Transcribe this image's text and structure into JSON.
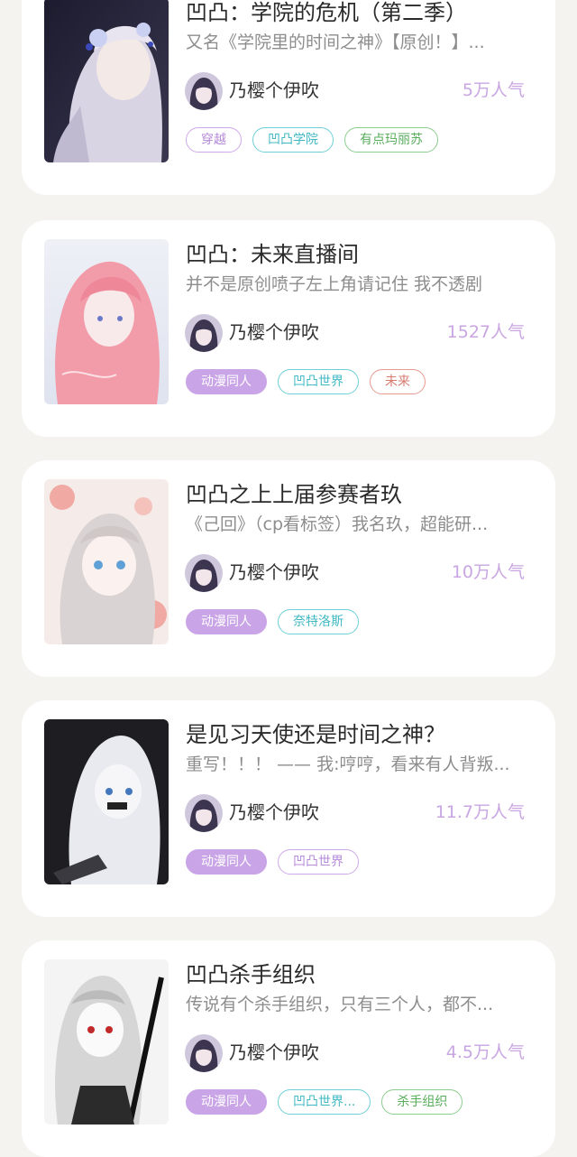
{
  "books": [
    {
      "title": "凹凸：学院的危机（第二季）",
      "description": "又名《学院里的时间之神》【原创！】...",
      "author": "乃樱个伊吹",
      "popularity": "5万人气",
      "tags": [
        {
          "label": "穿越",
          "style": "purple"
        },
        {
          "label": "凹凸学院",
          "style": "teal"
        },
        {
          "label": "有点玛丽苏",
          "style": "green"
        }
      ]
    },
    {
      "title": "凹凸：未来直播间",
      "description": "并不是原创喷子左上角请记住 我不透剧",
      "author": "乃樱个伊吹",
      "popularity": "1527人气",
      "tags": [
        {
          "label": "动漫同人",
          "style": "filled"
        },
        {
          "label": "凹凸世界",
          "style": "teal"
        },
        {
          "label": "未来",
          "style": "red"
        }
      ]
    },
    {
      "title": "凹凸之上上届参赛者玖",
      "description": "《己回》（cp看标签）我名玖，超能研...",
      "author": "乃樱个伊吹",
      "popularity": "10万人气",
      "tags": [
        {
          "label": "动漫同人",
          "style": "filled"
        },
        {
          "label": "奈特洛斯",
          "style": "teal"
        }
      ]
    },
    {
      "title": "是见习天使还是时间之神？",
      "description": "重写！！！ —— 我:哼哼，看来有人背叛...",
      "author": "乃樱个伊吹",
      "popularity": "11.7万人气",
      "tags": [
        {
          "label": "动漫同人",
          "style": "filled"
        },
        {
          "label": "凹凸世界",
          "style": "purple"
        }
      ]
    },
    {
      "title": "凹凸杀手组织",
      "description": "传说有个杀手组织，只有三个人，都不...",
      "author": "乃樱个伊吹",
      "popularity": "4.5万人气",
      "tags": [
        {
          "label": "动漫同人",
          "style": "filled"
        },
        {
          "label": "凹凸世界...",
          "style": "teal"
        },
        {
          "label": "杀手组织",
          "style": "green"
        }
      ]
    }
  ]
}
